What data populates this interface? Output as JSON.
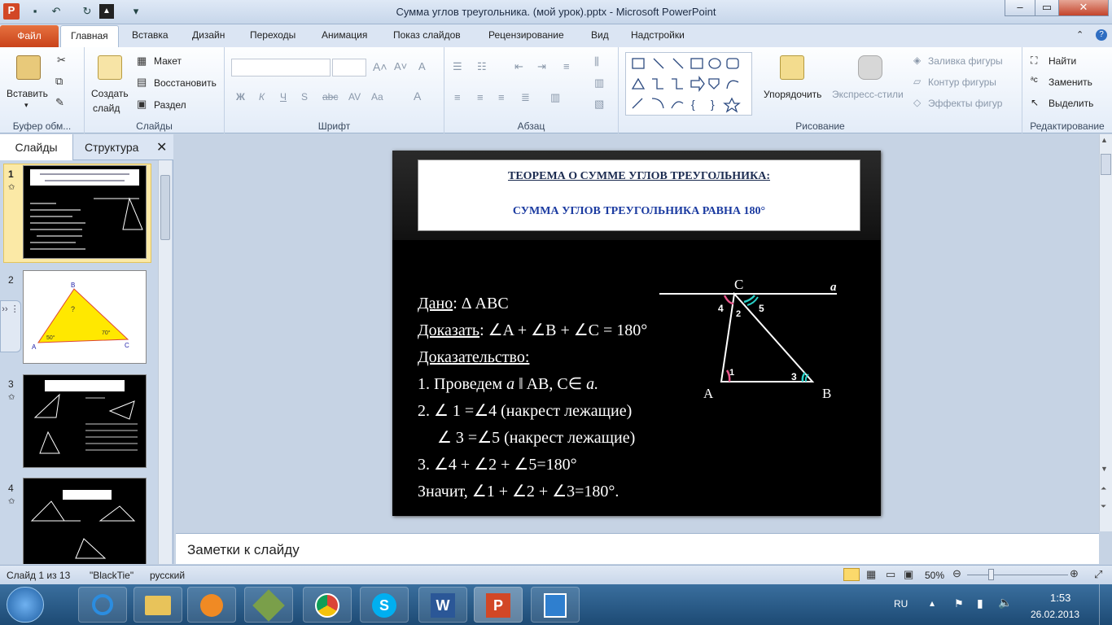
{
  "window": {
    "title": "Сумма углов треугольника. (мой урок).pptx - Microsoft PowerPoint"
  },
  "tabs": [
    "Файл",
    "Главная",
    "Вставка",
    "Дизайн",
    "Переходы",
    "Анимация",
    "Показ слайдов",
    "Рецензирование",
    "Вид",
    "Надстройки"
  ],
  "ribbon": {
    "clipboard": {
      "paste": "Вставить",
      "label": "Буфер обм..."
    },
    "slides": {
      "create": "Создать",
      "create2": "слайд",
      "layout": "Макет",
      "reset": "Восстановить",
      "section": "Раздел",
      "label": "Слайды"
    },
    "font": {
      "label": "Шрифт",
      "bold": "Ж",
      "italic": "К",
      "underline": "Ч",
      "strike": "S",
      "shadow": "abc"
    },
    "paragraph": {
      "label": "Абзац"
    },
    "drawing": {
      "arrange": "Упорядочить",
      "styles": "Экспресс-стили",
      "fill": "Заливка фигуры",
      "outline": "Контур фигуры",
      "effects": "Эффекты фигур",
      "label": "Рисование"
    },
    "editing": {
      "find": "Найти",
      "replace": "Заменить",
      "select": "Выделить",
      "label": "Редактирование"
    }
  },
  "panel": {
    "tab_slides": "Слайды",
    "tab_outline": "Структура",
    "numbers": [
      "1",
      "2",
      "3",
      "4"
    ]
  },
  "slide": {
    "title1": "ТЕОРЕМА О СУММЕ УГЛОВ ТРЕУГОЛЬНИКА:",
    "title2": "СУММА УГЛОВ ТРЕУГОЛЬНИКА  РАВНА 180°",
    "given_label": "Дано",
    "given": ":  Δ ABC",
    "prove_label": "Доказать",
    "prove": ":  ∠A + ∠B + ∠C = 180°",
    "proof_label": "Доказательство:",
    "step1a": "1. Проведем ",
    "step1b": "a",
    "step1c": " ‖ AB,  C∈ ",
    "step1d": "a.",
    "step2": "2. ∠ 1 =∠4 (накрест лежащие)",
    "step2b": "∠ 3 =∠5 (накрест лежащие)",
    "step3": "3. ∠4 + ∠2 + ∠5=180°",
    "conclusion": "Значит, ∠1 + ∠2 + ∠3=180°.",
    "fig": {
      "C": "C",
      "A": "A",
      "B": "B",
      "a": "a",
      "n4": "4",
      "n2": "2",
      "n5": "5",
      "n1": "1",
      "n3": "3"
    }
  },
  "thumb2": {
    "B": "B",
    "A": "A",
    "C": "C",
    "q": "?",
    "a50": "50°",
    "a70": "70°"
  },
  "notes": {
    "placeholder": "Заметки к слайду"
  },
  "status": {
    "slide": "Слайд 1 из 13",
    "theme": "\"BlackTie\"",
    "lang": "русский",
    "zoom": "50%"
  },
  "taskbar": {
    "lang": "RU",
    "time": "1:53",
    "date": "26.02.2013"
  }
}
